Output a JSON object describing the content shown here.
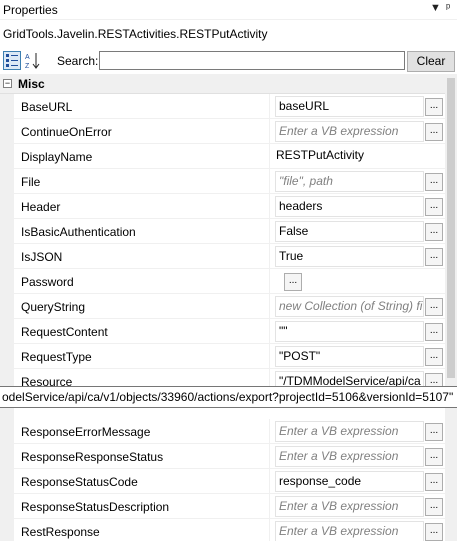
{
  "panel": {
    "title": "Properties",
    "dropdown_glyph": "▼",
    "pin_glyph": "ᵖ"
  },
  "object_name": "GridTools.Javelin.RESTActivities.RESTPutActivity",
  "toolbar": {
    "categorized_icon": "categorized-icon",
    "alphabetical_icon": "sort-alphabetical-icon",
    "search_label": "Search:",
    "search_value": "",
    "clear_label": "Clear"
  },
  "category": {
    "toggle": "−",
    "label": "Misc"
  },
  "properties": [
    {
      "name": "BaseURL",
      "value": "baseURL",
      "kind": "box",
      "button": "..."
    },
    {
      "name": "ContinueOnError",
      "value": "Enter a VB expression",
      "kind": "placeholder",
      "button": "..."
    },
    {
      "name": "DisplayName",
      "value": "RESTPutActivity",
      "kind": "plain",
      "button": ""
    },
    {
      "name": "File",
      "value": "\"file\", path",
      "kind": "placeholder",
      "button": "..."
    },
    {
      "name": "Header",
      "value": "headers",
      "kind": "box",
      "button": "..."
    },
    {
      "name": "IsBasicAuthentication",
      "value": "False",
      "kind": "box",
      "button": "..."
    },
    {
      "name": "IsJSON",
      "value": "True",
      "kind": "box",
      "button": "..."
    },
    {
      "name": "Password",
      "value": "",
      "kind": "inline-button",
      "button": "..."
    },
    {
      "name": "QueryString",
      "value": "new Collection (of String) fi",
      "kind": "placeholder",
      "button": "..."
    },
    {
      "name": "RequestContent",
      "value": "\"\"",
      "kind": "box",
      "button": "..."
    },
    {
      "name": "RequestType",
      "value": "\"POST\"",
      "kind": "box",
      "button": "..."
    },
    {
      "name": "Resource",
      "value": "\"/TDMModelService/api/ca",
      "kind": "box",
      "button": "..."
    },
    {
      "name": "",
      "value": "",
      "kind": "hidden",
      "button": ""
    },
    {
      "name": "ResponseErrorMessage",
      "value": "Enter a VB expression",
      "kind": "placeholder",
      "button": "..."
    },
    {
      "name": "ResponseResponseStatus",
      "value": "Enter a VB expression",
      "kind": "placeholder",
      "button": "..."
    },
    {
      "name": "ResponseStatusCode",
      "value": "response_code",
      "kind": "box",
      "button": "..."
    },
    {
      "name": "ResponseStatusDescription",
      "value": "Enter a VB expression",
      "kind": "placeholder",
      "button": "..."
    },
    {
      "name": "RestResponse",
      "value": "Enter a VB expression",
      "kind": "placeholder",
      "button": "..."
    }
  ],
  "tooltip": "odelService/api/ca/v1/objects/33960/actions/export?projectId=5106&versionId=5107\""
}
